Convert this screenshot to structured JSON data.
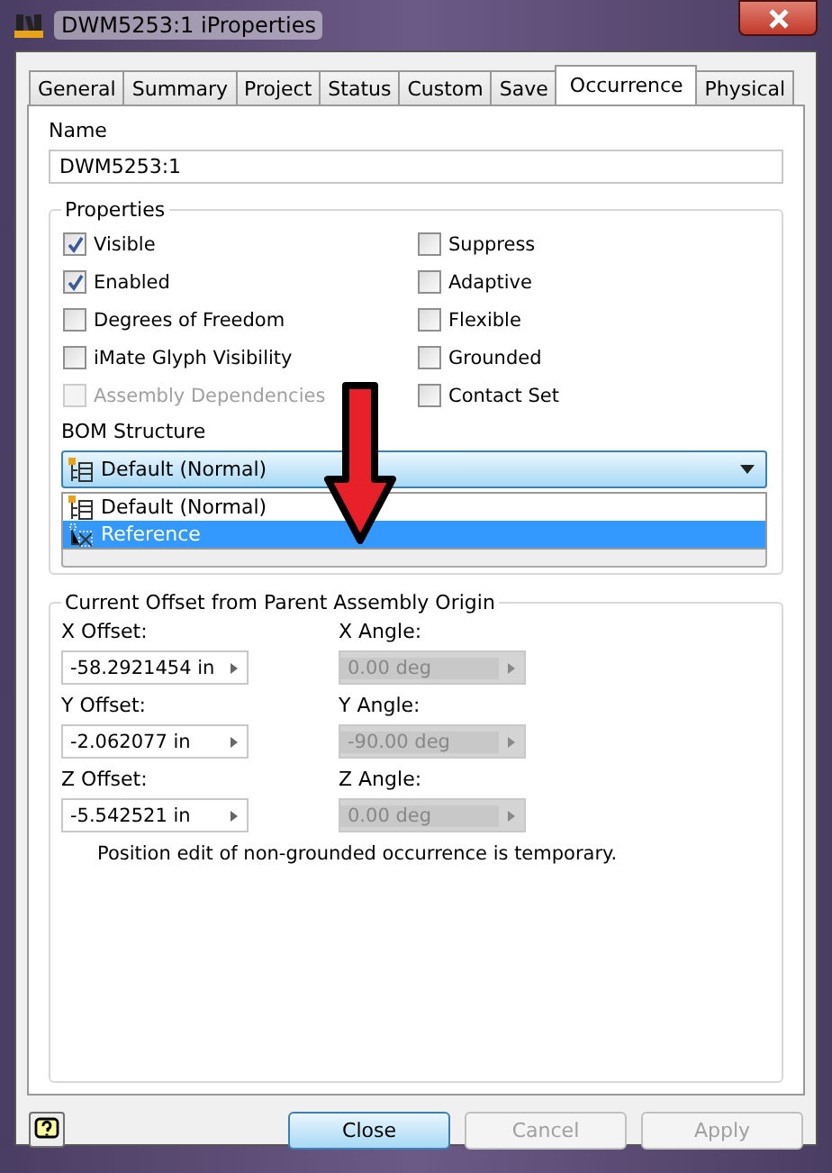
{
  "window": {
    "title": "DWM5253:1 iProperties"
  },
  "tabs": [
    {
      "label": "General",
      "selected": false
    },
    {
      "label": "Summary",
      "selected": false
    },
    {
      "label": "Project",
      "selected": false
    },
    {
      "label": "Status",
      "selected": false
    },
    {
      "label": "Custom",
      "selected": false
    },
    {
      "label": "Save",
      "selected": false
    },
    {
      "label": "Occurrence",
      "selected": true
    },
    {
      "label": "Physical",
      "selected": false
    }
  ],
  "name": {
    "label": "Name",
    "value": "DWM5253:1"
  },
  "properties": {
    "title": "Properties",
    "left": [
      {
        "label": "Visible",
        "checked": true,
        "disabled": false
      },
      {
        "label": "Enabled",
        "checked": true,
        "disabled": false
      },
      {
        "label": "Degrees of Freedom",
        "checked": false,
        "disabled": false
      },
      {
        "label": "iMate Glyph Visibility",
        "checked": false,
        "disabled": false
      },
      {
        "label": "Assembly Dependencies",
        "checked": false,
        "disabled": true
      }
    ],
    "right": [
      {
        "label": "Suppress",
        "checked": false,
        "disabled": false
      },
      {
        "label": "Adaptive",
        "checked": false,
        "disabled": false
      },
      {
        "label": "Flexible",
        "checked": false,
        "disabled": false
      },
      {
        "label": "Grounded",
        "checked": false,
        "disabled": false
      },
      {
        "label": "Contact Set",
        "checked": false,
        "disabled": false
      }
    ],
    "bom_label": "BOM Structure",
    "bom_value": "Default (Normal)",
    "bom_options": [
      {
        "label": "Default (Normal)",
        "kind": "normal",
        "selected": false
      },
      {
        "label": "Reference",
        "kind": "reference",
        "selected": true
      }
    ]
  },
  "offset": {
    "title": "Current Offset from Parent Assembly Origin",
    "rows": [
      {
        "offset_label": "X Offset:",
        "offset_value": "-58.2921454 in",
        "angle_label": "X Angle:",
        "angle_value": "0.00 deg",
        "angle_disabled": true
      },
      {
        "offset_label": "Y Offset:",
        "offset_value": "-2.062077 in",
        "angle_label": "Y Angle:",
        "angle_value": "-90.00 deg",
        "angle_disabled": true
      },
      {
        "offset_label": "Z Offset:",
        "offset_value": "-5.542521 in",
        "angle_label": "Z Angle:",
        "angle_value": "0.00 deg",
        "angle_disabled": true
      }
    ],
    "note": "Position edit of non-grounded occurrence is temporary."
  },
  "buttons": [
    {
      "label": "Close",
      "disabled": false,
      "default": true
    },
    {
      "label": "Cancel",
      "disabled": true,
      "default": false
    },
    {
      "label": "Apply",
      "disabled": true,
      "default": false
    }
  ]
}
